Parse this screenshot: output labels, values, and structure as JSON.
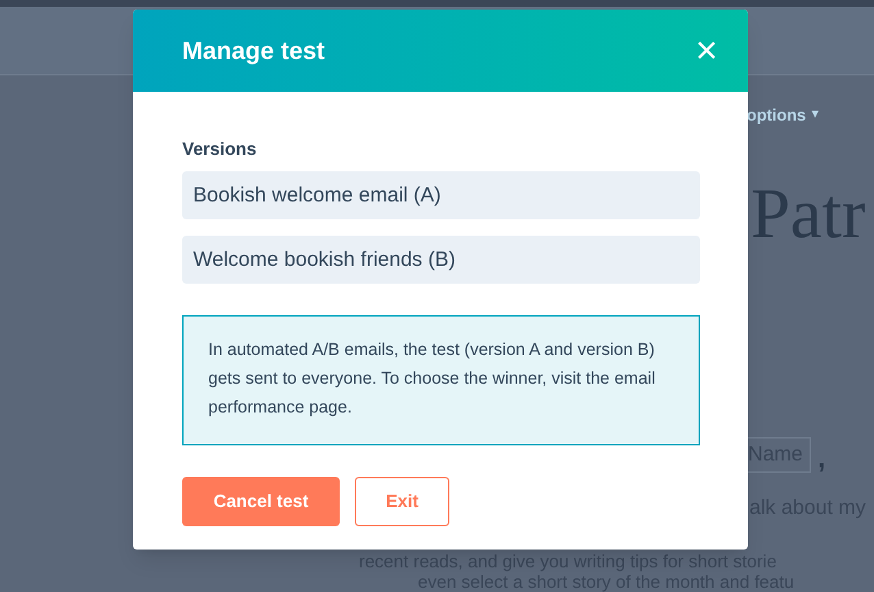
{
  "background_page": {
    "options_link": "options",
    "caret": "▾",
    "heading": "Patr",
    "token": "Name",
    "comma": ",",
    "body_lines": [
      "alk about my",
      "recent reads, and give you writing tips for short storie",
      "even select a short story of the month and featu"
    ]
  },
  "modal": {
    "title": "Manage test",
    "close": "×",
    "versions_label": "Versions",
    "versions": [
      {
        "value": "Bookish welcome email (A)"
      },
      {
        "value": "Welcome bookish friends (B)"
      }
    ],
    "notice": "In automated A/B emails, the test (version A and version B) gets sent to everyone. To choose the winner, visit the email performance page.",
    "buttons": [
      {
        "label": "Cancel test",
        "kind": "primary"
      },
      {
        "label": "Exit",
        "kind": "secondary"
      }
    ]
  }
}
